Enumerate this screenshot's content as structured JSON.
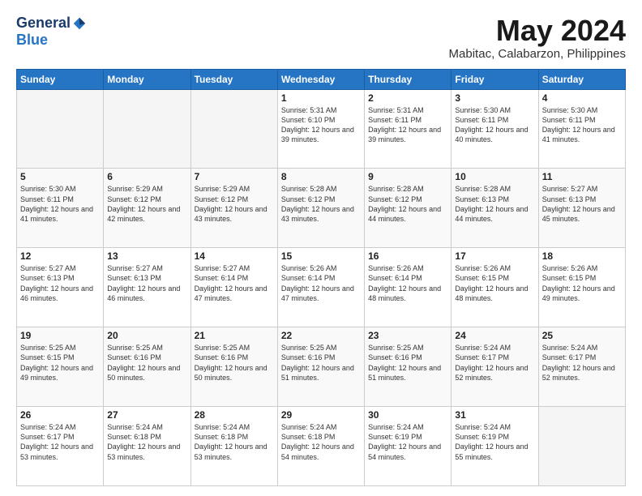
{
  "header": {
    "logo_general": "General",
    "logo_blue": "Blue",
    "month_year": "May 2024",
    "location": "Mabitac, Calabarzon, Philippines"
  },
  "days_of_week": [
    "Sunday",
    "Monday",
    "Tuesday",
    "Wednesday",
    "Thursday",
    "Friday",
    "Saturday"
  ],
  "weeks": [
    [
      {
        "day": "",
        "content": ""
      },
      {
        "day": "",
        "content": ""
      },
      {
        "day": "",
        "content": ""
      },
      {
        "day": "1",
        "content": "Sunrise: 5:31 AM\nSunset: 6:10 PM\nDaylight: 12 hours\nand 39 minutes."
      },
      {
        "day": "2",
        "content": "Sunrise: 5:31 AM\nSunset: 6:11 PM\nDaylight: 12 hours\nand 39 minutes."
      },
      {
        "day": "3",
        "content": "Sunrise: 5:30 AM\nSunset: 6:11 PM\nDaylight: 12 hours\nand 40 minutes."
      },
      {
        "day": "4",
        "content": "Sunrise: 5:30 AM\nSunset: 6:11 PM\nDaylight: 12 hours\nand 41 minutes."
      }
    ],
    [
      {
        "day": "5",
        "content": "Sunrise: 5:30 AM\nSunset: 6:11 PM\nDaylight: 12 hours\nand 41 minutes."
      },
      {
        "day": "6",
        "content": "Sunrise: 5:29 AM\nSunset: 6:12 PM\nDaylight: 12 hours\nand 42 minutes."
      },
      {
        "day": "7",
        "content": "Sunrise: 5:29 AM\nSunset: 6:12 PM\nDaylight: 12 hours\nand 43 minutes."
      },
      {
        "day": "8",
        "content": "Sunrise: 5:28 AM\nSunset: 6:12 PM\nDaylight: 12 hours\nand 43 minutes."
      },
      {
        "day": "9",
        "content": "Sunrise: 5:28 AM\nSunset: 6:12 PM\nDaylight: 12 hours\nand 44 minutes."
      },
      {
        "day": "10",
        "content": "Sunrise: 5:28 AM\nSunset: 6:13 PM\nDaylight: 12 hours\nand 44 minutes."
      },
      {
        "day": "11",
        "content": "Sunrise: 5:27 AM\nSunset: 6:13 PM\nDaylight: 12 hours\nand 45 minutes."
      }
    ],
    [
      {
        "day": "12",
        "content": "Sunrise: 5:27 AM\nSunset: 6:13 PM\nDaylight: 12 hours\nand 46 minutes."
      },
      {
        "day": "13",
        "content": "Sunrise: 5:27 AM\nSunset: 6:13 PM\nDaylight: 12 hours\nand 46 minutes."
      },
      {
        "day": "14",
        "content": "Sunrise: 5:27 AM\nSunset: 6:14 PM\nDaylight: 12 hours\nand 47 minutes."
      },
      {
        "day": "15",
        "content": "Sunrise: 5:26 AM\nSunset: 6:14 PM\nDaylight: 12 hours\nand 47 minutes."
      },
      {
        "day": "16",
        "content": "Sunrise: 5:26 AM\nSunset: 6:14 PM\nDaylight: 12 hours\nand 48 minutes."
      },
      {
        "day": "17",
        "content": "Sunrise: 5:26 AM\nSunset: 6:15 PM\nDaylight: 12 hours\nand 48 minutes."
      },
      {
        "day": "18",
        "content": "Sunrise: 5:26 AM\nSunset: 6:15 PM\nDaylight: 12 hours\nand 49 minutes."
      }
    ],
    [
      {
        "day": "19",
        "content": "Sunrise: 5:25 AM\nSunset: 6:15 PM\nDaylight: 12 hours\nand 49 minutes."
      },
      {
        "day": "20",
        "content": "Sunrise: 5:25 AM\nSunset: 6:16 PM\nDaylight: 12 hours\nand 50 minutes."
      },
      {
        "day": "21",
        "content": "Sunrise: 5:25 AM\nSunset: 6:16 PM\nDaylight: 12 hours\nand 50 minutes."
      },
      {
        "day": "22",
        "content": "Sunrise: 5:25 AM\nSunset: 6:16 PM\nDaylight: 12 hours\nand 51 minutes."
      },
      {
        "day": "23",
        "content": "Sunrise: 5:25 AM\nSunset: 6:16 PM\nDaylight: 12 hours\nand 51 minutes."
      },
      {
        "day": "24",
        "content": "Sunrise: 5:24 AM\nSunset: 6:17 PM\nDaylight: 12 hours\nand 52 minutes."
      },
      {
        "day": "25",
        "content": "Sunrise: 5:24 AM\nSunset: 6:17 PM\nDaylight: 12 hours\nand 52 minutes."
      }
    ],
    [
      {
        "day": "26",
        "content": "Sunrise: 5:24 AM\nSunset: 6:17 PM\nDaylight: 12 hours\nand 53 minutes."
      },
      {
        "day": "27",
        "content": "Sunrise: 5:24 AM\nSunset: 6:18 PM\nDaylight: 12 hours\nand 53 minutes."
      },
      {
        "day": "28",
        "content": "Sunrise: 5:24 AM\nSunset: 6:18 PM\nDaylight: 12 hours\nand 53 minutes."
      },
      {
        "day": "29",
        "content": "Sunrise: 5:24 AM\nSunset: 6:18 PM\nDaylight: 12 hours\nand 54 minutes."
      },
      {
        "day": "30",
        "content": "Sunrise: 5:24 AM\nSunset: 6:19 PM\nDaylight: 12 hours\nand 54 minutes."
      },
      {
        "day": "31",
        "content": "Sunrise: 5:24 AM\nSunset: 6:19 PM\nDaylight: 12 hours\nand 55 minutes."
      },
      {
        "day": "",
        "content": ""
      }
    ]
  ]
}
